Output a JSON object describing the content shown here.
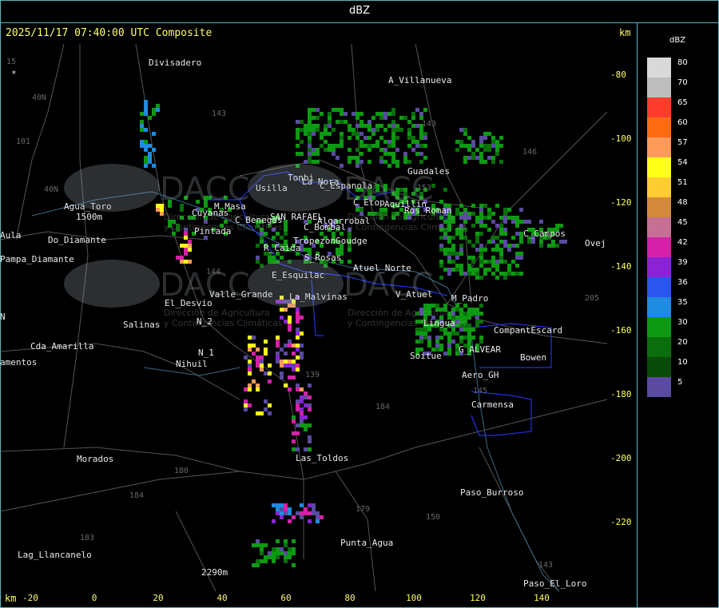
{
  "window": {
    "title": "dBZ"
  },
  "header": {
    "timestamp": "2025/11/17 07:40:00 UTC Composite",
    "unit_top": "km",
    "unit_bottom": "km"
  },
  "legend": {
    "title": "dBZ",
    "entries": [
      {
        "label": "80",
        "color": "#d9d9d9"
      },
      {
        "label": "70",
        "color": "#bdbdbd"
      },
      {
        "label": "65",
        "color": "#ff3b2a"
      },
      {
        "label": "60",
        "color": "#ff6a12"
      },
      {
        "label": "57",
        "color": "#ff9a5a"
      },
      {
        "label": "54",
        "color": "#ffff1a"
      },
      {
        "label": "51",
        "color": "#ffcc33"
      },
      {
        "label": "48",
        "color": "#d48a3a"
      },
      {
        "label": "45",
        "color": "#c77096"
      },
      {
        "label": "42",
        "color": "#d620a8"
      },
      {
        "label": "39",
        "color": "#8a22d6"
      },
      {
        "label": "36",
        "color": "#2a55ee"
      },
      {
        "label": "35",
        "color": "#1e8ce0"
      },
      {
        "label": "30",
        "color": "#0d9a12"
      },
      {
        "label": "20",
        "color": "#0a6e0c"
      },
      {
        "label": "10",
        "color": "#0a4a0a"
      },
      {
        "label": "5",
        "color": "#5a4aa0"
      }
    ]
  },
  "axes": {
    "y_ticks": [
      "-80",
      "-100",
      "-120",
      "-140",
      "-160",
      "-180",
      "-200",
      "-220"
    ],
    "x_ticks": [
      "-20",
      "0",
      "20",
      "40",
      "60",
      "80",
      "100",
      "120",
      "140"
    ]
  },
  "places": [
    "Divisadero",
    "A_Villanueva",
    "Usilla",
    "La Nora",
    "C_Espanola",
    "Tonbi",
    "C_Etop",
    "Aquillin",
    "Ros_Roman",
    "Agua_Toro",
    "1500m",
    "Aula",
    "Do_Diamante",
    "Pampa_Diamante",
    "M_Masa",
    "Cuyanas",
    "C_Benegas",
    "SAN RAFAEL",
    "Algarrobal",
    "Pintada",
    "C_Bombal",
    "R_Caida",
    "Tropezon",
    "Goudge",
    "S_Rosas",
    "Atuel_Norte",
    "El_Desvio",
    "Valle_Grande",
    "La_Malvinas",
    "E_Esquilac",
    "V_Atuel",
    "Salinas",
    "N_2",
    "N_1",
    "Nihuil",
    "Cda_Amarilla",
    "amentos",
    "Morados",
    "Las_Toldos",
    "Lag_Llancanelo",
    "2290m",
    "Punta_Agua",
    "Paso_Burroso",
    "Paso_El_Loro",
    "Carmensa",
    "Aero_GH",
    "G_ALVEAR",
    "Bowen",
    "CompantEscard",
    "Soitue",
    "Guadales",
    "C_Campos",
    "Ovej",
    "M_Padro",
    "Lingua"
  ],
  "route_labels": [
    "40N",
    "101",
    "143",
    "40N",
    "144",
    "146",
    "143",
    "153",
    "184",
    "180",
    "184",
    "183",
    "179",
    "150",
    "139",
    "145",
    "143",
    "205",
    "15"
  ],
  "watermark": {
    "brand": "DACC",
    "lines": [
      "Dirección de Agricultura",
      "y Contingencias Climáticas"
    ]
  },
  "symbols": {
    "corner": "*",
    "edge_left": "N"
  }
}
